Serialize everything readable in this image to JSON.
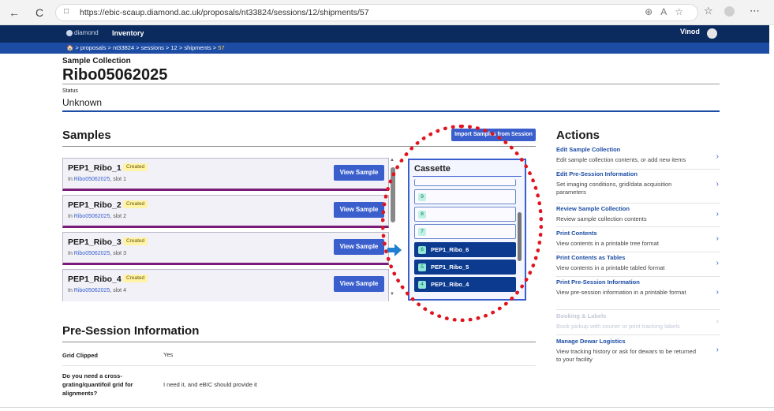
{
  "browser": {
    "url": "https://ebic-scaup.diamond.ac.uk/proposals/nt33824/sessions/12/shipments/57",
    "back_icon": "←",
    "reload_icon": "C"
  },
  "app": {
    "logo_text": "diamond",
    "nav_inventory": "Inventory",
    "user_name": "Vinod"
  },
  "breadcrumb": {
    "home_icon": "home-icon",
    "items": [
      "proposals",
      "nt33824",
      "sessions",
      "12",
      "shipments"
    ],
    "current": "57",
    "separator": ">"
  },
  "page": {
    "collection_label": "Sample Collection",
    "collection_name": "Ribo05062025",
    "status_label": "Status",
    "status_value": "Unknown"
  },
  "samples": {
    "heading": "Samples",
    "import_button": "Import Samples from Session",
    "items": [
      {
        "name": "PEP1_Ribo_1",
        "badge": "Created",
        "in_label": "In",
        "collection": "Ribo05062025",
        "slot": ", slot 1",
        "button": "View Sample"
      },
      {
        "name": "PEP1_Ribo_2",
        "badge": "Created",
        "in_label": "In",
        "collection": "Ribo05062025",
        "slot": ", slot 2",
        "button": "View Sample"
      },
      {
        "name": "PEP1_Ribo_3",
        "badge": "Created",
        "in_label": "In",
        "collection": "Ribo05062025",
        "slot": ", slot 3",
        "button": "View Sample"
      },
      {
        "name": "PEP1_Ribo_4",
        "badge": "Created",
        "in_label": "In",
        "collection": "Ribo05062025",
        "slot": ", slot 4",
        "button": "View Sample"
      }
    ]
  },
  "cassette": {
    "title": "Cassette",
    "slots": [
      {
        "num": "9",
        "name": ""
      },
      {
        "num": "8",
        "name": ""
      },
      {
        "num": "7",
        "name": ""
      },
      {
        "num": "6",
        "name": "PEP1_Ribo_6"
      },
      {
        "num": "5",
        "name": "PEP1_Ribo_5"
      },
      {
        "num": "4",
        "name": "PEP1_Ribo_4"
      }
    ]
  },
  "actions": {
    "heading": "Actions",
    "items": [
      {
        "title": "Edit Sample Collection",
        "desc": "Edit sample collection contents, or add new items"
      },
      {
        "title": "Edit Pre-Session Information",
        "desc": "Set imaging conditions, grid/data acquisition parameters"
      },
      {
        "title": "Review Sample Collection",
        "desc": "Review sample collection contents"
      },
      {
        "title": "Print Contents",
        "desc": "View contents in a printable tree format"
      },
      {
        "title": "Print Contents as Tables",
        "desc": "View contents in a printable tabled format"
      },
      {
        "title": "Print Pre-Session Information",
        "desc": "View pre-session information in a printable format"
      },
      {
        "title": "Booking & Labels",
        "desc": "Book pickup with courier or print tracking labels"
      },
      {
        "title": "Manage Dewar Logistics",
        "desc": "View tracking history or ask for dewars to be returned to your facility"
      }
    ]
  },
  "pre_session": {
    "heading": "Pre-Session Information",
    "rows": [
      {
        "key": "Grid Clipped",
        "value": "Yes"
      },
      {
        "key": "Do you need a cross-grating/quantifoil grid for alignments?",
        "value": "I need it, and eBIC should provide it"
      }
    ]
  },
  "colors": {
    "header": "#0b2b5e",
    "breadcrumb_bar": "#1c4ca3",
    "button": "#3a5fcd",
    "annotation_circle": "#e0141e",
    "annotation_arrow": "#1f7fd0",
    "badge": "#fff3a8"
  }
}
